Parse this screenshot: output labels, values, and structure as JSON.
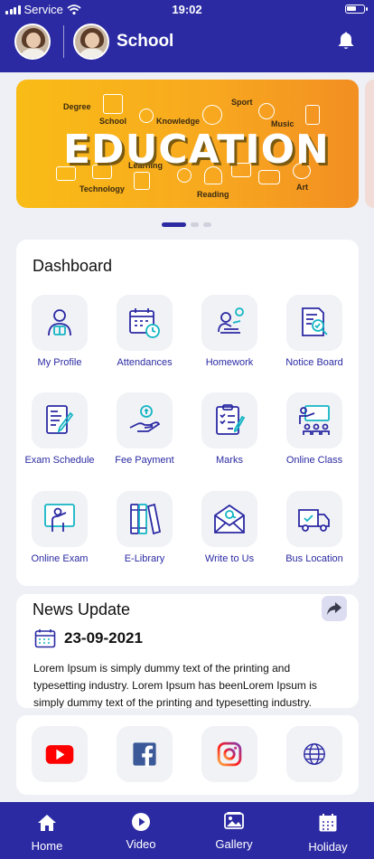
{
  "status_bar": {
    "carrier": "Service",
    "time": "19:02"
  },
  "header": {
    "title": "School"
  },
  "banner": {
    "headline": "EDUCATION",
    "tags": [
      "Degree",
      "School",
      "Knowledge",
      "Sport",
      "Music",
      "Learning",
      "Technology",
      "Reading",
      "Art"
    ]
  },
  "dashboard": {
    "title": "Dashboard",
    "items": [
      {
        "label": "My Profile",
        "icon": "profile-icon"
      },
      {
        "label": "Attendances",
        "icon": "calendar-clock-icon"
      },
      {
        "label": "Homework",
        "icon": "homework-icon"
      },
      {
        "label": "Notice Board",
        "icon": "notice-board-icon"
      },
      {
        "label": "Exam Schedule",
        "icon": "exam-schedule-icon"
      },
      {
        "label": "Fee Payment",
        "icon": "fee-payment-icon"
      },
      {
        "label": "Marks",
        "icon": "marks-icon"
      },
      {
        "label": "Online Class",
        "icon": "online-class-icon"
      },
      {
        "label": "Online Exam",
        "icon": "online-exam-icon"
      },
      {
        "label": "E-Library",
        "icon": "books-icon"
      },
      {
        "label": "Write to Us",
        "icon": "email-icon"
      },
      {
        "label": "Bus Location",
        "icon": "delivery-truck-icon"
      }
    ]
  },
  "news": {
    "title": "News Update",
    "date": "23-09-2021",
    "body": "Lorem Ipsum is simply dummy text of the printing and typesetting industry. Lorem Ipsum has beenLorem Ipsum is simply dummy text of the printing and typesetting industry."
  },
  "social": [
    "youtube-icon",
    "facebook-icon",
    "instagram-icon",
    "globe-icon"
  ],
  "nav": [
    {
      "label": "Home",
      "icon": "home-icon"
    },
    {
      "label": "Video",
      "icon": "play-icon"
    },
    {
      "label": "Gallery",
      "icon": "gallery-icon"
    },
    {
      "label": "Holiday",
      "icon": "calendar-icon"
    }
  ],
  "colors": {
    "primary": "#2b2aa3",
    "accent": "#14b5c4",
    "banner": "#f9b21b",
    "youtube": "#ff0000",
    "facebook": "#3b5998"
  }
}
